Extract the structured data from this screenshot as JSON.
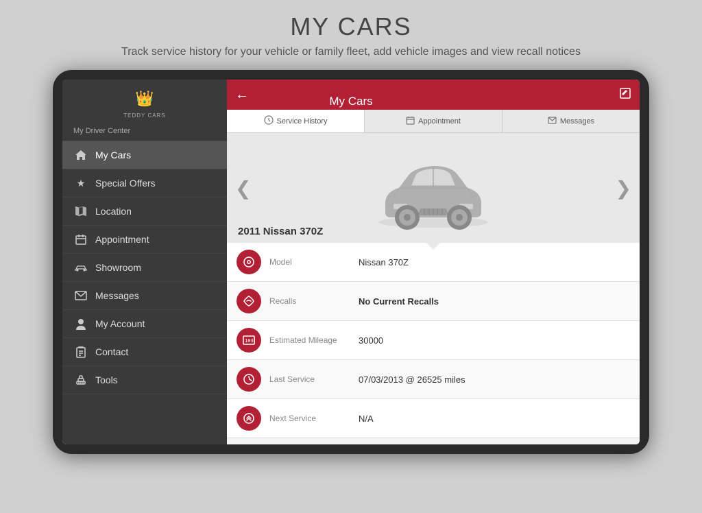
{
  "header": {
    "title": "MY CARS",
    "subtitle": "Track service history for your vehicle or family fleet,\nadd vehicle images and view recall notices"
  },
  "sidebar": {
    "logo_symbol": "👑",
    "logo_text": "TEDDY CARS",
    "driver_center_label": "My Driver Center",
    "items": [
      {
        "id": "my-cars",
        "label": "My Cars",
        "icon": "🏠",
        "active": true
      },
      {
        "id": "special-offers",
        "label": "Special Offers",
        "icon": "★",
        "active": false
      },
      {
        "id": "location",
        "label": "Location",
        "icon": "🗺",
        "active": false
      },
      {
        "id": "appointment",
        "label": "Appointment",
        "icon": "📅",
        "active": false
      },
      {
        "id": "showroom",
        "label": "Showroom",
        "icon": "🚗",
        "active": false
      },
      {
        "id": "messages",
        "label": "Messages",
        "icon": "✉",
        "active": false
      },
      {
        "id": "my-account",
        "label": "My Account",
        "icon": "👤",
        "active": false
      },
      {
        "id": "contact",
        "label": "Contact",
        "icon": "📋",
        "active": false
      },
      {
        "id": "tools",
        "label": "Tools",
        "icon": "🔧",
        "active": false
      }
    ]
  },
  "topbar": {
    "back_label": "←",
    "title": "My Cars",
    "edit_label": "✎"
  },
  "tabs": [
    {
      "id": "service-history",
      "label": "Service History",
      "icon": "⚙"
    },
    {
      "id": "appointment",
      "label": "Appointment",
      "icon": "📅"
    },
    {
      "id": "messages",
      "label": "Messages",
      "icon": "✉"
    }
  ],
  "car_display": {
    "car_name": "2011 Nissan 370Z",
    "left_arrow": "❮",
    "right_arrow": "❯"
  },
  "car_details": [
    {
      "id": "model",
      "label": "Model",
      "value": "Nissan 370Z",
      "icon": "⊙",
      "bold": false
    },
    {
      "id": "recalls",
      "label": "Recalls",
      "value": "No Current Recalls",
      "icon": "↺",
      "bold": true
    },
    {
      "id": "mileage",
      "label": "Estimated Mileage",
      "value": "30000",
      "icon": "🔢",
      "bold": false
    },
    {
      "id": "last-service",
      "label": "Last Service",
      "value": "07/03/2013 @ 26525 miles",
      "icon": "⚙",
      "bold": false
    },
    {
      "id": "next-service",
      "label": "Next Service",
      "value": "N/A",
      "icon": "⚙",
      "bold": false
    }
  ],
  "colors": {
    "accent": "#b22035",
    "sidebar_bg": "#3a3a3a",
    "topbar_bg": "#b22035"
  }
}
